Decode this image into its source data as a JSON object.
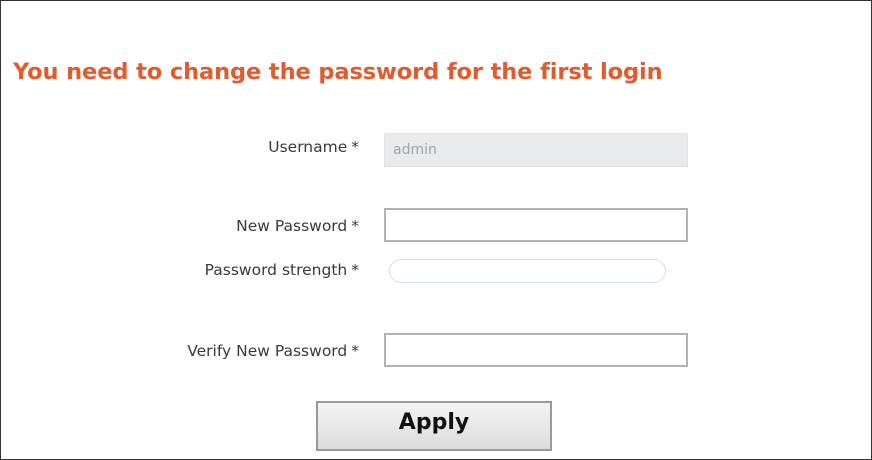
{
  "heading": "You need to change the password for the first login",
  "form": {
    "username": {
      "label": "Username",
      "required_mark": "*",
      "value": "admin"
    },
    "new_password": {
      "label": "New Password",
      "required_mark": "*",
      "value": ""
    },
    "password_strength": {
      "label": "Password strength",
      "required_mark": "*",
      "level": 0
    },
    "verify_password": {
      "label": "Verify New Password",
      "required_mark": "*",
      "value": ""
    }
  },
  "apply_button": {
    "label": "Apply"
  },
  "colors": {
    "heading": "#e35a2c",
    "field_border": "#b3b3b3",
    "readonly_bg": "#e8eaec"
  }
}
